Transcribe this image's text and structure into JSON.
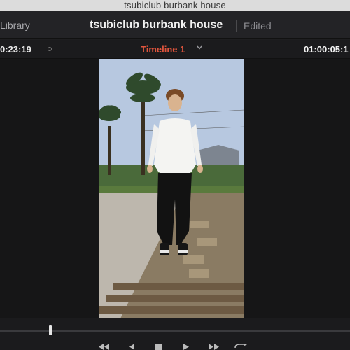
{
  "os_window": {
    "title": "tsubiclub burbank house"
  },
  "header": {
    "library_label": "Library",
    "project_title": "tsubiclub burbank house",
    "status": "Edited"
  },
  "viewer": {
    "source_timecode": "0:23:19",
    "timeline_name": "Timeline 1",
    "record_timecode": "01:00:05:1",
    "frame_description_icons": [
      "palm-trees",
      "person-standing",
      "stone-path"
    ]
  },
  "transport": {
    "buttons": [
      "skip-back-icon",
      "step-back-icon",
      "stop-icon",
      "play-icon",
      "skip-forward-icon",
      "loop-icon"
    ]
  },
  "colors": {
    "timeline_accent": "#e0553d",
    "background": "#1e1e20"
  }
}
